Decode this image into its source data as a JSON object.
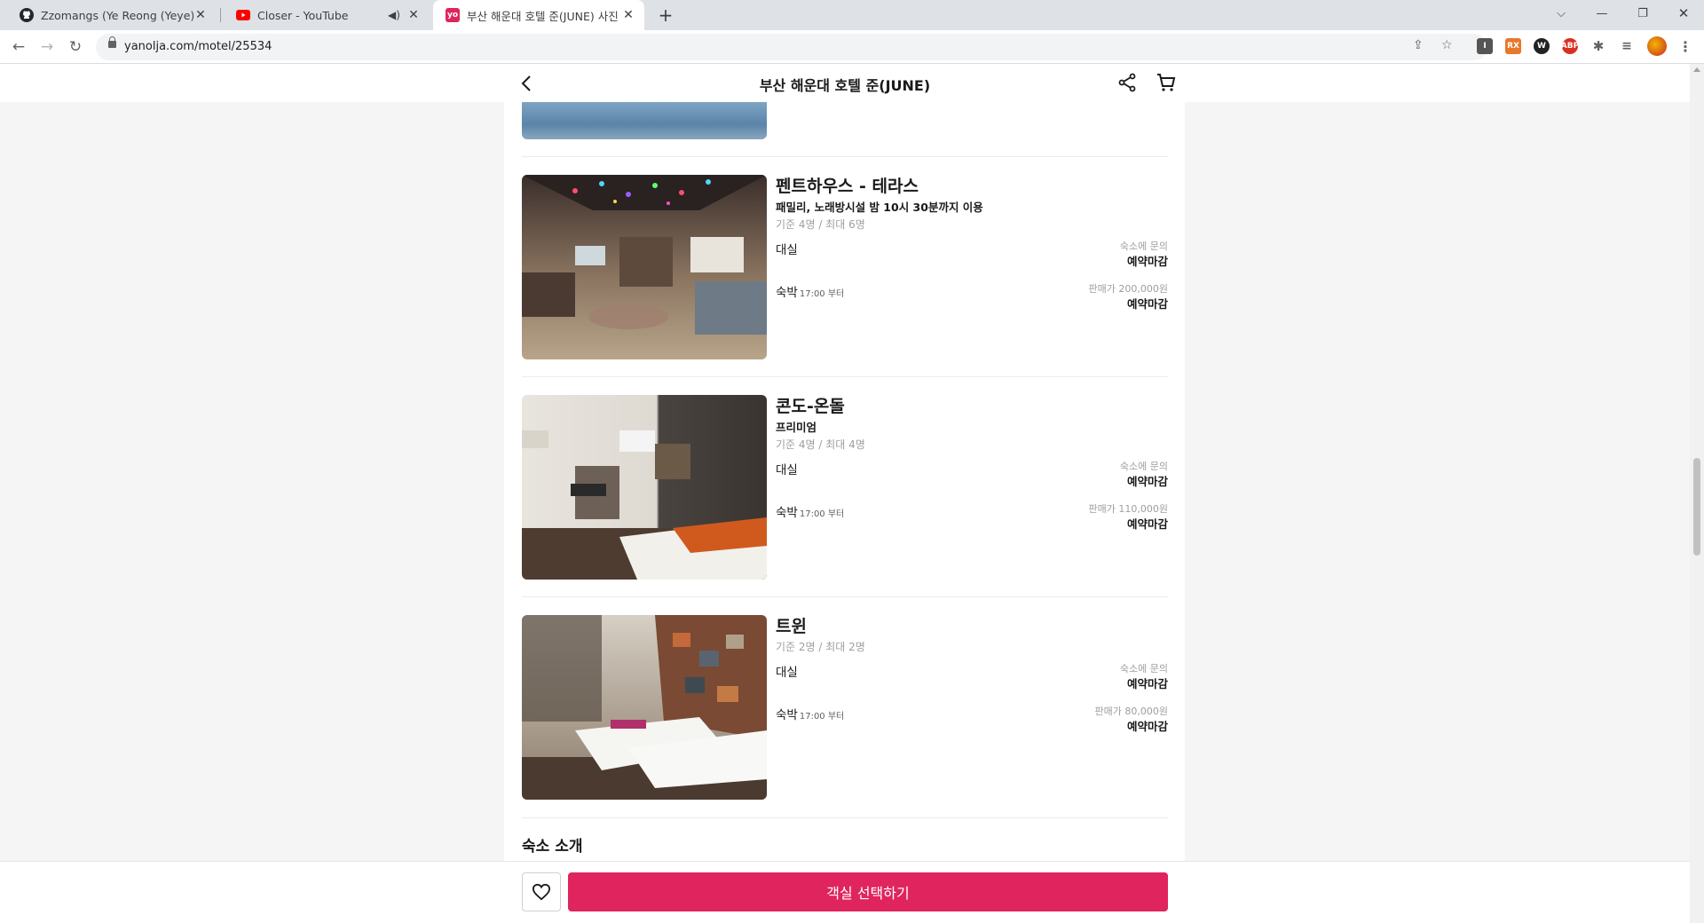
{
  "browser": {
    "tabs": [
      {
        "title": "Zzomangs (Ye Reong (Yeye))",
        "icon": "github-icon"
      },
      {
        "title": "Closer - YouTube",
        "icon": "youtube-icon"
      },
      {
        "title": "부산 해운대 호텔 준(JUNE) 사진",
        "icon": "yanolja-icon",
        "favicon_text": "yo"
      }
    ],
    "url": "yanolja.com/motel/25534"
  },
  "header": {
    "title": "부산 해운대 호텔 준(JUNE)"
  },
  "rooms": [
    {
      "name": "펜트하우스 - 테라스",
      "desc": "패밀리, 노래방시설 밤 10시 30분까지 이용",
      "capacity": "기준 4명 / 최대 6명",
      "daystay_label": "대실",
      "daystay_note": "숙소에 문의",
      "daystay_status": "예약마감",
      "stay_label": "숙박",
      "stay_time": "17:00 부터",
      "stay_price": "판매가 200,000원",
      "stay_status": "예약마감"
    },
    {
      "name": "콘도-온돌",
      "desc": "프리미엄",
      "capacity": "기준 4명 / 최대 4명",
      "daystay_label": "대실",
      "daystay_note": "숙소에 문의",
      "daystay_status": "예약마감",
      "stay_label": "숙박",
      "stay_time": "17:00 부터",
      "stay_price": "판매가 110,000원",
      "stay_status": "예약마감"
    },
    {
      "name": "트윈",
      "capacity": "기준 2명 / 최대 2명",
      "daystay_label": "대실",
      "daystay_note": "숙소에 문의",
      "daystay_status": "예약마감",
      "stay_label": "숙박",
      "stay_time": "17:00 부터",
      "stay_price": "판매가 80,000원",
      "stay_status": "예약마감"
    }
  ],
  "intro": {
    "title": "숙소 소개"
  },
  "footer": {
    "cta_label": "객실 선택하기"
  },
  "colors": {
    "brand": "#e0245e"
  }
}
